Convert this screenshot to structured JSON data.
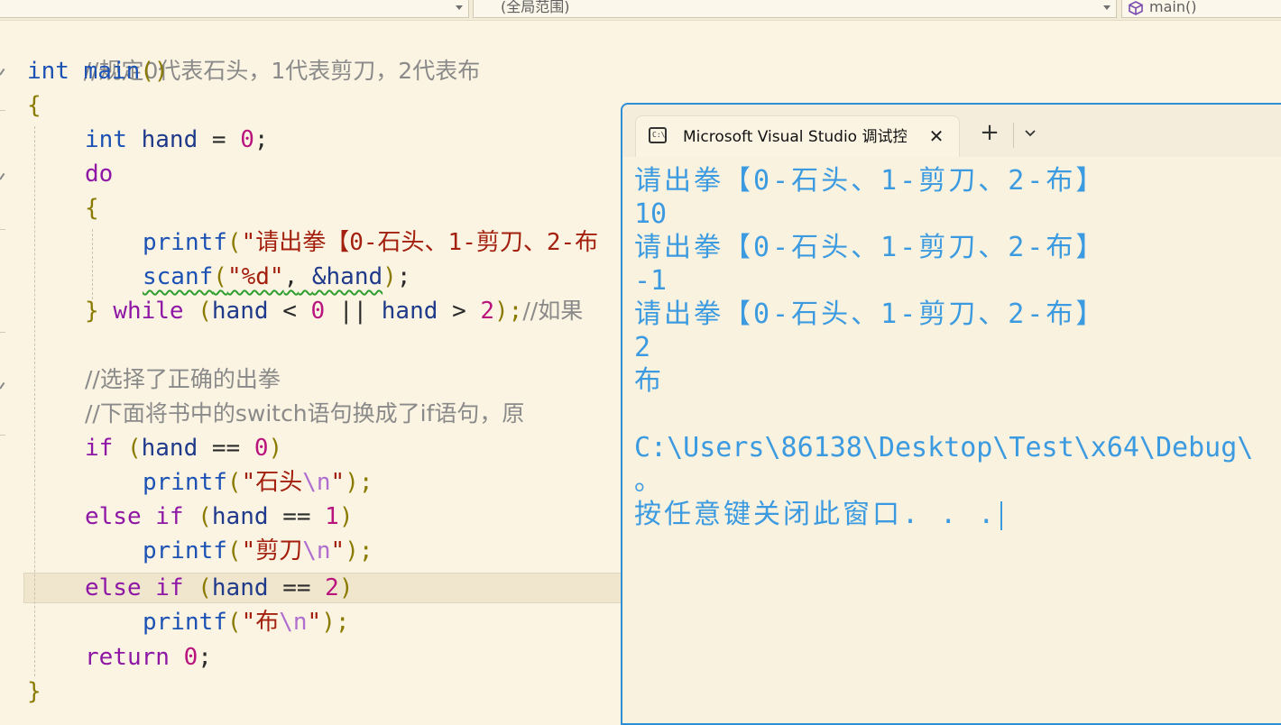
{
  "navbar": {
    "scope": "(全局范围)",
    "member": "main()"
  },
  "editor": {
    "lines": [
      "//规定0代表石头，1代表剪刀，2代表布",
      "int",
      "main",
      "()",
      "{",
      "int",
      "hand",
      "=",
      "0",
      ";",
      "do",
      "{",
      "printf",
      "(",
      "\"请出拳【0-石头、1-剪刀、2-布",
      "scanf",
      "(",
      "\"%d\"",
      ",",
      "&hand",
      ")",
      ";",
      "}",
      "while",
      "(",
      "hand",
      "<",
      "0",
      "||",
      "hand",
      ">",
      "2",
      ");",
      "//如果",
      "//选择了正确的出拳",
      "//下面将书中的switch语句换成了if语句，原",
      "if",
      "(",
      "hand",
      "==",
      "0",
      ")",
      "printf",
      "(",
      "\"石头",
      "\\n",
      "\"",
      ");",
      "else",
      "if",
      "(",
      "hand",
      "==",
      "1",
      ")",
      "printf",
      "(",
      "\"剪刀",
      "\\n",
      "\"",
      ");",
      "else",
      "if",
      "(",
      "hand",
      "==",
      "2",
      ")",
      "printf",
      "(",
      "\"布",
      "\\n",
      "\"",
      ");",
      "return",
      "0",
      ";",
      "}"
    ]
  },
  "terminal": {
    "title": "Microsoft Visual Studio 调试控",
    "close_label": "✕",
    "newtab_label": "+",
    "output": [
      "请出拳【0-石头、1-剪刀、2-布】",
      "10",
      "请出拳【0-石头、1-剪刀、2-布】",
      "-1",
      "请出拳【0-石头、1-剪刀、2-布】",
      "2",
      "布",
      "",
      "C:\\Users\\86138\\Desktop\\Test\\x64\\Debug\\",
      "。",
      "按任意键关闭此窗口. . ."
    ]
  },
  "colors": {
    "editor_bg": "#fbf4e2",
    "terminal_text": "#3b9ae0",
    "terminal_border": "#2f8fd6",
    "keyword": "#8f17a6",
    "type": "#1d52b5",
    "number": "#b9137e",
    "string": "#a3200f",
    "comment": "#8a8a8a"
  }
}
